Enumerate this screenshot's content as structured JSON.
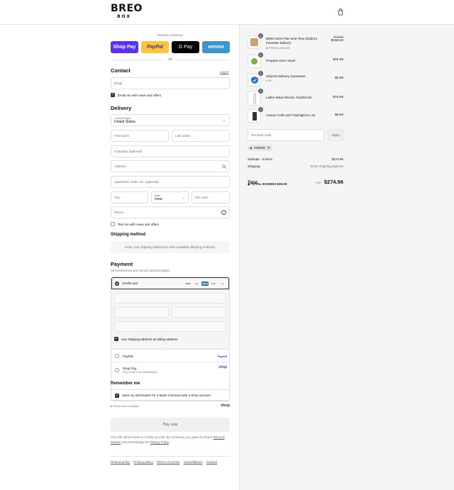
{
  "brand": {
    "name": "BREO",
    "sub": "BOX"
  },
  "express": {
    "title": "Express checkout",
    "buttons": [
      "Shop Pay",
      "PayPal",
      "G Pay",
      "venmo"
    ],
    "or": "OR"
  },
  "contact": {
    "title": "Contact",
    "login": "Log in",
    "email_placeholder": "Email",
    "news_label": "Email me with news and offers"
  },
  "delivery": {
    "title": "Delivery",
    "country_label": "Country/Region",
    "country_value": "United States",
    "first_name": "First name",
    "last_name": "Last name",
    "company": "Company (optional)",
    "address": "Address",
    "apartment": "Apartment, suite, etc. (optional)",
    "city": "City",
    "state_label": "State",
    "state_value": "Iowa",
    "zip": "ZIP code",
    "phone": "Phone",
    "text_label": "Text me with news and offers"
  },
  "shipping": {
    "title": "Shipping method",
    "note": "Enter your shipping address to view available shipping methods."
  },
  "payment": {
    "title": "Payment",
    "subtitle": "All transactions are secure and encrypted.",
    "credit_card": "Credit card",
    "card_brands": [
      "VISA",
      "MC",
      "AMEX",
      "DISC"
    ],
    "more_cards": "+4",
    "billing_label": "Use shipping address as billing address",
    "paypal": "PayPal",
    "paypal_logo": "PayPal",
    "shoppay": "Shop Pay",
    "shoppay_sub": "Pay in full or in installments",
    "shoppay_logo": "shop"
  },
  "remember": {
    "title": "Remember me",
    "label": "Save my information for a faster checkout with a Shop account",
    "secure": "Secure and encrypted",
    "shop": "shop"
  },
  "pay_now": "Pay now",
  "fine_print": {
    "text1": "Your info will be saved to a Shop account. By continuing, you agree to Shop's",
    "tos": "Terms of Service",
    "text2": "and acknowledge the",
    "privacy": "Privacy Policy",
    "end": "."
  },
  "footer_links": [
    "Refund policy",
    "Privacy policy",
    "Terms of service",
    "Cancellations",
    "Contact"
  ],
  "items": [
    {
      "qty": "1",
      "name": "BREO BOX Plus One-Time (Editor's Favorites Edition)",
      "sub": "FIRE20 (-$20.00)",
      "old_price": "$179.00",
      "price": "$159.00",
      "thumb_color": "#c9a36a"
    },
    {
      "qty": "1",
      "name": "Propane Gusc Saver",
      "sub": "",
      "old_price": "",
      "price": "$25.99",
      "thumb_color": "#7bb04a"
    },
    {
      "qty": "1",
      "name": "ShipAid Delivery Guarantee",
      "sub": "0.99",
      "old_price": "",
      "price": "$0.99",
      "thumb_color": "#2a6fd6"
    },
    {
      "qty": "1",
      "name": "Laifen Wave Electric Toothbrush",
      "sub": "",
      "old_price": "",
      "price": "$79.99",
      "thumb_color": "#e8e8e8"
    },
    {
      "qty": "1",
      "name": "Carson COB LED Flashlight KL-20",
      "sub": "",
      "old_price": "",
      "price": "$8.99",
      "thumb_color": "#2b3340"
    }
  ],
  "discount": {
    "placeholder": "Discount code",
    "apply": "Apply",
    "code": "FIRE20"
  },
  "summary": {
    "subtotal_label": "Subtotal · 5 items",
    "subtotal": "$274.96",
    "shipping_label": "Shipping",
    "shipping": "Enter shipping address",
    "total_label": "Total",
    "currency": "USD",
    "total": "$274.96",
    "savings_label": "TOTAL SAVINGS",
    "savings": "$20.00"
  }
}
